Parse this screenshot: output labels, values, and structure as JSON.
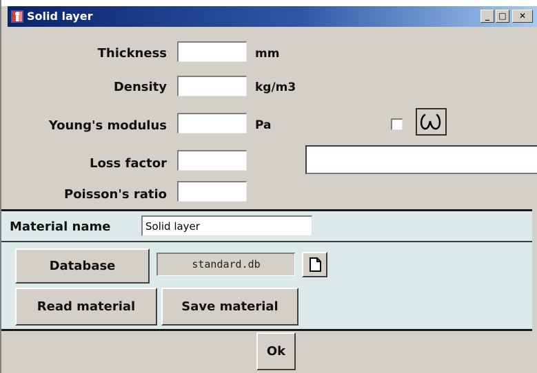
{
  "window": {
    "title": "Solid layer",
    "controls": {
      "minimize": "_",
      "maximize": "□",
      "close": "✕"
    }
  },
  "properties": {
    "thickness": {
      "label": "Thickness",
      "value": "",
      "unit": "mm"
    },
    "density": {
      "label": "Density",
      "value": "",
      "unit": "kg/m3"
    },
    "youngs_modulus": {
      "label": "Young's modulus",
      "value": "",
      "unit": "Pa"
    },
    "loss_factor": {
      "label": "Loss factor",
      "value": ""
    },
    "poissons_ratio": {
      "label": "Poisson's ratio",
      "value": ""
    }
  },
  "frequency_dependent": {
    "checked": false,
    "icon": "omega-icon",
    "expression": ""
  },
  "material": {
    "label": "Material name",
    "value": "Solid layer"
  },
  "database": {
    "button_label": "Database",
    "file": "standard.db",
    "new_icon": "new-file-icon"
  },
  "actions": {
    "read_label": "Read material",
    "save_label": "Save material",
    "ok_label": "Ok"
  },
  "colors": {
    "dialog_bg": "#d4d0c8",
    "panel_bg": "#dceaea",
    "title_start": "#0a246a",
    "title_end": "#a6caf0"
  }
}
